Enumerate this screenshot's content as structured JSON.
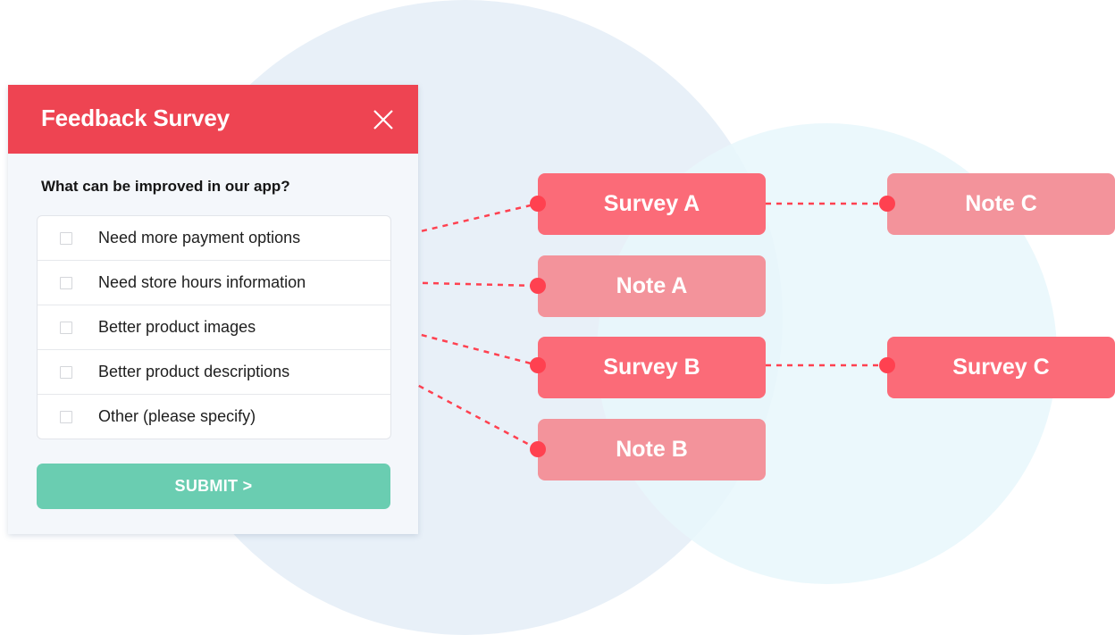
{
  "colors": {
    "header": "#EE4452",
    "submit": "#6ACDB1",
    "survey_node": "#FB6B78",
    "note_node": "#F3939B",
    "connector": "#FF4150",
    "circle_large": "#E8F0F8",
    "circle_small": "#E8F7FB"
  },
  "survey_panel": {
    "title": "Feedback Survey",
    "close_icon": "close-icon",
    "question": "What can be improved in our app?",
    "options": [
      {
        "label": "Need more payment options",
        "checked": false
      },
      {
        "label": "Need store hours information",
        "checked": false
      },
      {
        "label": "Better product images",
        "checked": false
      },
      {
        "label": "Better product descriptions",
        "checked": false
      },
      {
        "label": "Other (please specify)",
        "checked": false
      }
    ],
    "submit_label": "SUBMIT >"
  },
  "nodes": {
    "survey_a": {
      "label": "Survey A",
      "kind": "survey"
    },
    "note_a": {
      "label": "Note A",
      "kind": "note"
    },
    "survey_b": {
      "label": "Survey B",
      "kind": "survey"
    },
    "note_b": {
      "label": "Note B",
      "kind": "note"
    },
    "note_c": {
      "label": "Note C",
      "kind": "note"
    },
    "survey_c": {
      "label": "Survey C",
      "kind": "survey"
    }
  },
  "connections": [
    {
      "from": "option-0",
      "to": "survey_a"
    },
    {
      "from": "option-1",
      "to": "note_a"
    },
    {
      "from": "option-2",
      "to": "survey_b"
    },
    {
      "from": "option-3",
      "to": "note_b"
    },
    {
      "from": "survey_a",
      "to": "note_c"
    },
    {
      "from": "survey_b",
      "to": "survey_c"
    }
  ]
}
